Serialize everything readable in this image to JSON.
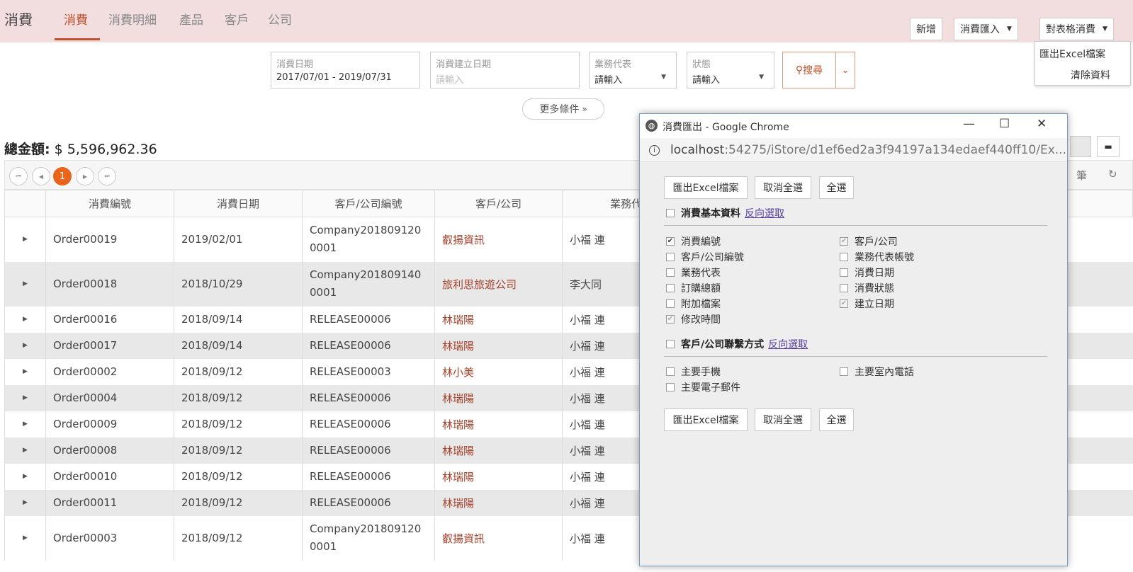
{
  "app": {
    "title": "消費",
    "tabs": [
      "消費",
      "消費明細",
      "產品",
      "客戶",
      "公司"
    ]
  },
  "toolbar": {
    "new_label": "新增",
    "import_label": "消費匯入",
    "table_label": "對表格消費",
    "menu": [
      "匯出Excel檔案",
      "清除資料"
    ]
  },
  "filters": {
    "date": {
      "label": "消費日期",
      "value": "2017/07/01 - 2019/07/31"
    },
    "created": {
      "label": "消費建立日期",
      "placeholder": "請輸入"
    },
    "rep": {
      "label": "業務代表",
      "value": "請輸入"
    },
    "status": {
      "label": "狀態",
      "value": "請輸入"
    },
    "search_label": "搜尋",
    "more_label": "更多條件"
  },
  "summary": {
    "label": "總金額:",
    "value": "$ 5,596,962.36"
  },
  "pager": {
    "current": "1",
    "count_unit": "筆"
  },
  "table": {
    "headers": [
      "消費編號",
      "消費日期",
      "客戶/公司編號",
      "客戶/公司",
      "業務代"
    ],
    "rows": [
      {
        "id": "Order00019",
        "date": "2019/02/01",
        "code1": "Company201809120",
        "code2": "0001",
        "customer": "叡揚資訊",
        "rep": "小福 連"
      },
      {
        "id": "Order00018",
        "date": "2018/10/29",
        "code1": "Company201809140",
        "code2": "0001",
        "customer": "旅利思旅遊公司",
        "rep": "李大同"
      },
      {
        "id": "Order00016",
        "date": "2018/09/14",
        "code1": "RELEASE00006",
        "code2": "",
        "customer": "林瑞陽",
        "rep": "小福 連"
      },
      {
        "id": "Order00017",
        "date": "2018/09/14",
        "code1": "RELEASE00006",
        "code2": "",
        "customer": "林瑞陽",
        "rep": "小福 連"
      },
      {
        "id": "Order00002",
        "date": "2018/09/12",
        "code1": "RELEASE00003",
        "code2": "",
        "customer": "林小美",
        "rep": "小福 連"
      },
      {
        "id": "Order00004",
        "date": "2018/09/12",
        "code1": "RELEASE00006",
        "code2": "",
        "customer": "林瑞陽",
        "rep": "小福 連"
      },
      {
        "id": "Order00009",
        "date": "2018/09/12",
        "code1": "RELEASE00006",
        "code2": "",
        "customer": "林瑞陽",
        "rep": "小福 連"
      },
      {
        "id": "Order00008",
        "date": "2018/09/12",
        "code1": "RELEASE00006",
        "code2": "",
        "customer": "林瑞陽",
        "rep": "小福 連"
      },
      {
        "id": "Order00010",
        "date": "2018/09/12",
        "code1": "RELEASE00006",
        "code2": "",
        "customer": "林瑞陽",
        "rep": "小福 連"
      },
      {
        "id": "Order00011",
        "date": "2018/09/12",
        "code1": "RELEASE00006",
        "code2": "",
        "customer": "林瑞陽",
        "rep": "小福 連"
      },
      {
        "id": "Order00003",
        "date": "2018/09/12",
        "code1": "Company201809120",
        "code2": "0001",
        "customer": "叡揚資訊",
        "rep": "小福 連"
      }
    ]
  },
  "popup": {
    "title": "消費匯出 - Google Chrome",
    "url_host": "localhost",
    "url_rest": ":54275/iStore/d1ef6ed2a3f94197a134edaef440ff10/Ex...",
    "export_label": "匯出Excel檔案",
    "deselect_label": "取消全選",
    "select_all_label": "全選",
    "section1": {
      "title": "消費基本資料",
      "invert": "反向選取"
    },
    "section2": {
      "title": "客戶/公司聯繫方式",
      "invert": "反向選取"
    },
    "basic_fields": [
      {
        "label": "消費編號",
        "checked": true
      },
      {
        "label": "客戶/公司",
        "checked": true
      },
      {
        "label": "客戶/公司編號",
        "checked": false
      },
      {
        "label": "業務代表帳號",
        "checked": false
      },
      {
        "label": "業務代表",
        "checked": false
      },
      {
        "label": "消費日期",
        "checked": false
      },
      {
        "label": "訂購總額",
        "checked": false
      },
      {
        "label": "消費狀態",
        "checked": false
      },
      {
        "label": "附加檔案",
        "checked": false
      },
      {
        "label": "建立日期",
        "checked": true
      },
      {
        "label": "修改時間",
        "checked": true
      }
    ],
    "contact_fields": [
      {
        "label": "主要手機",
        "checked": false
      },
      {
        "label": "主要室內電話",
        "checked": false
      },
      {
        "label": "主要電子郵件",
        "checked": false
      }
    ]
  }
}
